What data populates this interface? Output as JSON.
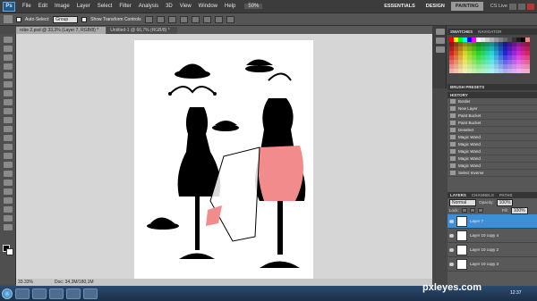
{
  "menubar": {
    "logo": "Ps",
    "items": [
      "File",
      "Edit",
      "Image",
      "Layer",
      "Select",
      "Filter",
      "Analysis",
      "3D",
      "View",
      "Window",
      "Help"
    ],
    "zoom_readout": "50%",
    "workspaces": [
      "ESSENTIALS",
      "DESIGN",
      "PAINTING"
    ],
    "cs_live": "CS Live"
  },
  "optionsbar": {
    "auto_select": "Auto-Select:",
    "group_select": "Group",
    "show_transform": "Show Transform Controls"
  },
  "tabs": [
    {
      "label": "robe 2.psd @ 33,3% (Layer 7, RGB/8) *",
      "active": true
    },
    {
      "label": "Untitled-1 @ 66,7% (RGB/8) *",
      "active": false
    }
  ],
  "status": {
    "zoom": "33.33%",
    "doc": "Doc: 34,3M/180,1M"
  },
  "panels": {
    "swatches_tabs": [
      "SWATCHES",
      "NAVIGATOR"
    ],
    "brush_presets": "BRUSH PRESETS",
    "history_title": "HISTORY",
    "history_items": [
      "Border",
      "New Layer",
      "Paint Bucket",
      "Paint Bucket",
      "Deselect",
      "Magic Wand",
      "Magic Wand",
      "Magic Wand",
      "Magic Wand",
      "Magic Wand",
      "Select Inverse"
    ],
    "layers_tabs": [
      "LAYERS",
      "CHANNELS",
      "PATHS"
    ],
    "blend_mode": "Normal",
    "opacity_label": "Opacity:",
    "opacity_value": "100%",
    "lock_label": "Lock:",
    "fill_label": "Fill:",
    "fill_value": "100%",
    "layers": [
      {
        "name": "Layer 7",
        "active": true
      },
      {
        "name": "Layer 10 copy 4",
        "active": false
      },
      {
        "name": "Layer 10 copy 2",
        "active": false
      },
      {
        "name": "Layer 10 copy 3",
        "active": false
      }
    ]
  },
  "swatch_colors": [
    "#ff0000",
    "#ffff00",
    "#00ff00",
    "#00ffff",
    "#0000ff",
    "#ff00ff",
    "#ffffff",
    "#e6e6e6",
    "#cccccc",
    "#b3b3b3",
    "#999999",
    "#808080",
    "#666666",
    "#4d4d4d",
    "#333333",
    "#1a1a1a",
    "#000000",
    "#ff8080"
  ],
  "accent": "#3d8fd8",
  "watermark": "pxleyes.com",
  "taskbar": {
    "time": "12:37"
  }
}
